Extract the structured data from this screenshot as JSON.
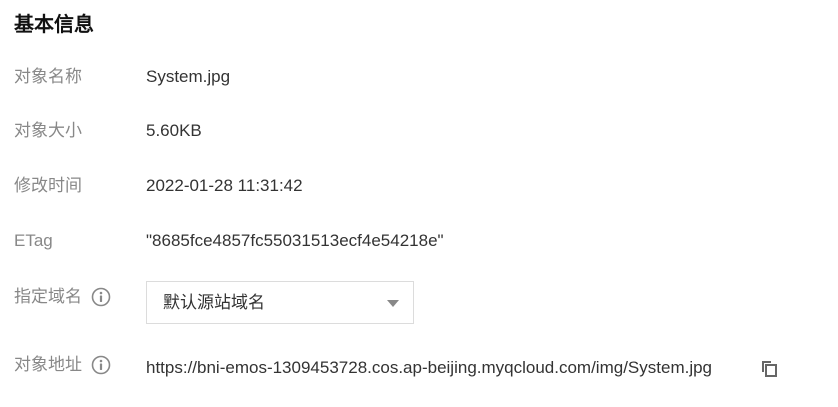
{
  "section": {
    "title": "基本信息"
  },
  "fields": {
    "object_name": {
      "label": "对象名称",
      "value": "System.jpg"
    },
    "object_size": {
      "label": "对象大小",
      "value": "5.60KB"
    },
    "modified_time": {
      "label": "修改时间",
      "value": "2022-01-28 11:31:42"
    },
    "etag": {
      "label": "ETag",
      "value": "\"8685fce4857fc55031513ecf4e54218e\""
    },
    "domain": {
      "label": "指定域名",
      "selected": "默认源站域名",
      "info_icon": "info-circle-icon"
    },
    "object_url": {
      "label": "对象地址",
      "value": "https://bni-emos-1309453728.cos.ap-beijing.myqcloud.com/img/System.jpg",
      "info_icon": "info-circle-icon",
      "copy_icon": "copy-icon"
    }
  },
  "colors": {
    "label": "#888888",
    "value": "#333333",
    "title": "#111111",
    "border": "#dcdcdc"
  }
}
